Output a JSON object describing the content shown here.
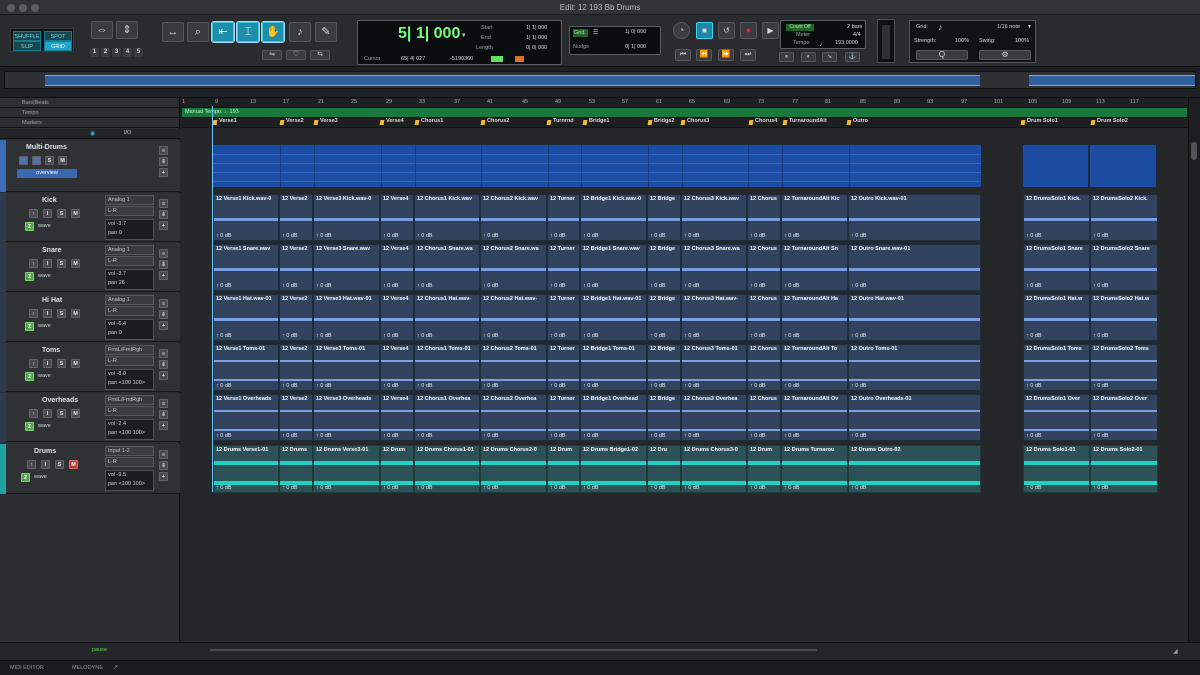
{
  "window": {
    "title": "Edit: 12 193 Bb Drums"
  },
  "toolbar": {
    "modes": [
      "SHUFFLE",
      "SPOT",
      "SLIP",
      "GRID"
    ],
    "zoom_presets": [
      "1",
      "2",
      "3",
      "4",
      "5"
    ],
    "main_counter": "5| 1| 000",
    "cursor_label": "Cursor",
    "cursor_value": "65| 4| 027",
    "sample_value": "-5190360",
    "start_label": "Start",
    "start_value": "1| 1| 000",
    "end_label": "End",
    "end_value": "1| 1| 000",
    "length_label": "Length",
    "length_value": "0| 0| 000",
    "grid_label": "Grid",
    "grid_value": "1| 0| 000",
    "nudge_label": "Nudge",
    "nudge_value": "0| 1| 000",
    "count_off": "Count Off",
    "count_bars": "2 bars",
    "meter_label": "Meter",
    "meter_value": "4/4",
    "tempo_label": "Tempo",
    "tempo_value": "193.0000",
    "midi_grid_label": "Grid:",
    "midi_grid_value": "1/16 note",
    "strength_label": "Strength:",
    "strength_value": "100%",
    "swing_label": "Swing:",
    "swing_value": "100%"
  },
  "rulers": {
    "bars": "Bars|Beats",
    "tempo": "Tempo",
    "markers": "Markers",
    "tempo_text": "Manual Tempo: ♩193",
    "io": "I/O"
  },
  "bar_numbers": [
    "1",
    "9",
    "13",
    "17",
    "21",
    "25",
    "29",
    "33",
    "37",
    "41",
    "45",
    "49",
    "53",
    "57",
    "61",
    "65",
    "69",
    "73",
    "77",
    "81",
    "85",
    "89",
    "93",
    "97",
    "101",
    "105",
    "109",
    "113",
    "117"
  ],
  "markers": [
    "Verse1",
    "Verse2",
    "Verse3",
    "Verse4",
    "Chorus1",
    "Chorus2",
    "Turnrnd",
    "Bridge1",
    "Bridge2",
    "Chorus3",
    "Chorus4",
    "TurnaroundAlt",
    "Outro",
    "Drum Solo1",
    "Drum Solo2"
  ],
  "tracks": [
    {
      "name": "Multi-Drums",
      "button": "overview"
    },
    {
      "name": "Kick",
      "io": "Analog 1",
      "pan": "L-R",
      "vol": "-3.7",
      "pan_val": "0"
    },
    {
      "name": "Snare",
      "io": "Analog 1",
      "pan": "L-R",
      "vol": "-3.7",
      "pan_val": "26"
    },
    {
      "name": "Hi Hat",
      "io": "Analog 1",
      "pan": "L-R",
      "vol": "-6.4",
      "pan_val": "0"
    },
    {
      "name": "Toms",
      "io": "FrntL/FrntRgh",
      "pan": "L-R",
      "vol": "-8.0",
      "pan_val": "<100  100>"
    },
    {
      "name": "Overheads",
      "io": "FrntL/FrntRgh",
      "pan": "L-R",
      "vol": "-2.4",
      "pan_val": "<100  100>"
    },
    {
      "name": "Drums",
      "io": "Input 1-2",
      "pan": "L-R",
      "vol": "-9.5",
      "pan_val": "<100  100>"
    }
  ],
  "clip_labels": {
    "kick": [
      "12 Verse1 Kick.wav-0",
      "12 Verse2",
      "12 Verse3 Kick.wav-0",
      "12 Verse4",
      "12 Chorus1 Kick.wav",
      "12 Chorus2 Kick.wav",
      "12 Turner",
      "12 Bridge1 Kick.wav-0",
      "12 Bridge",
      "12 Chorus3 Kick.wav",
      "12 Chorus",
      "12 TurnaroundAlt Kic",
      "12 Outro Kick.wav-01",
      "12 DrumsSolo1 Kick.",
      "12 DrumsSolo2 Kick."
    ],
    "snare": [
      "12 Verse1 Snare.wav",
      "12 Verse2",
      "12 Verse3 Snare.wav",
      "12 Verse4",
      "12 Chorus1 Snare.wa",
      "12 Chorus2 Snare.wa",
      "12 Turner",
      "12 Bridge1 Snare.wav",
      "12 Bridge",
      "12 Chorus3 Snare.wa",
      "12 Chorus",
      "12 TurnaroundAlt Sn",
      "12 Outro Snare.wav-01",
      "12 DrumsSolo1 Snare",
      "12 DrumsSolo2 Snare"
    ],
    "hihat": [
      "12 Verse1 Hat.wav-01",
      "12 Verse2",
      "12 Verse3 Hat.wav-01",
      "12 Verse4",
      "12 Chorus1 Hat.wav-",
      "12 Chorus2 Hat.wav-",
      "12 Turner",
      "12 Bridge1 Hat.wav-01",
      "12 Bridge",
      "12 Chorus3 Hat.wav-",
      "12 Chorus",
      "12 TurnaroundAlt Ha",
      "12 Outro Hat.wav-01",
      "12 DrumsSolo1 Hat.w",
      "12 DrumsSolo2 Hat.w"
    ],
    "toms": [
      "12 Verse1 Toms-01",
      "12 Verse2",
      "12 Verse3 Toms-01",
      "12 Verse4",
      "12 Chorus1 Toms-01",
      "12 Chorus2 Toms-01",
      "12 Turner",
      "12 Bridge1 Toms-01",
      "12 Bridge",
      "12 Chorus3 Toms-01",
      "12 Chorus",
      "12 TurnaroundAlt To",
      "12 Outro Toms-01",
      "12 DrumsSolo1 Toms",
      "12 DrumsSolo2 Toms"
    ],
    "overheads": [
      "12 Verse1 Overheads",
      "12 Verse2",
      "12 Verse3 Overheads",
      "12 Verse4",
      "12 Chorus1 Overhea",
      "12 Chorus2 Overhea",
      "12 Turner",
      "12 Bridge1 Overhead",
      "12 Bridge",
      "12 Chorus3 Overhea",
      "12 Chorus",
      "12 TurnaroundAlt Ov",
      "12 Outro Overheads-01",
      "12 DrumsSolo1 Over",
      "12 DrumsSolo2 Over"
    ],
    "drums": [
      "12 Drums Verse1-01",
      "12 Drums",
      "12 Drums Verse3-01",
      "12 Drum",
      "12 Drums Chorus1-01",
      "12 Drums Chorus2-0",
      "12 Drum",
      "12 Drums Bridge1-02",
      "12 Dru",
      "12 Drums Chorus3-0",
      "12 Drum",
      "12 Drums Turnarou",
      "12 Drums Outro-02",
      "12 Drums Solo1-01",
      "12 Drums Solo2-01"
    ]
  },
  "db_label": "0 dB",
  "status": {
    "pause": "pause",
    "tab1": "MIDI EDITOR",
    "tab2": "MELODYNE"
  }
}
